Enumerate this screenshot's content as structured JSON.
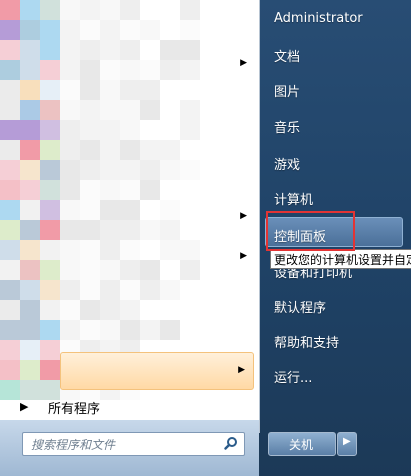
{
  "left_panel": {
    "rows_with_arrows": [
      "row-1",
      "row-2",
      "row-3",
      "row-4"
    ],
    "all_programs_label": "所有程序",
    "search_placeholder": "搜索程序和文件"
  },
  "right_panel": {
    "items": [
      "Administrator",
      "文档",
      "图片",
      "音乐",
      "游戏",
      "计算机",
      "控制面板",
      "设备和打印机",
      "默认程序",
      "帮助和支持",
      "运行..."
    ],
    "tooltip": "更改您的计算机设置并自定",
    "shutdown_label": "关机"
  }
}
